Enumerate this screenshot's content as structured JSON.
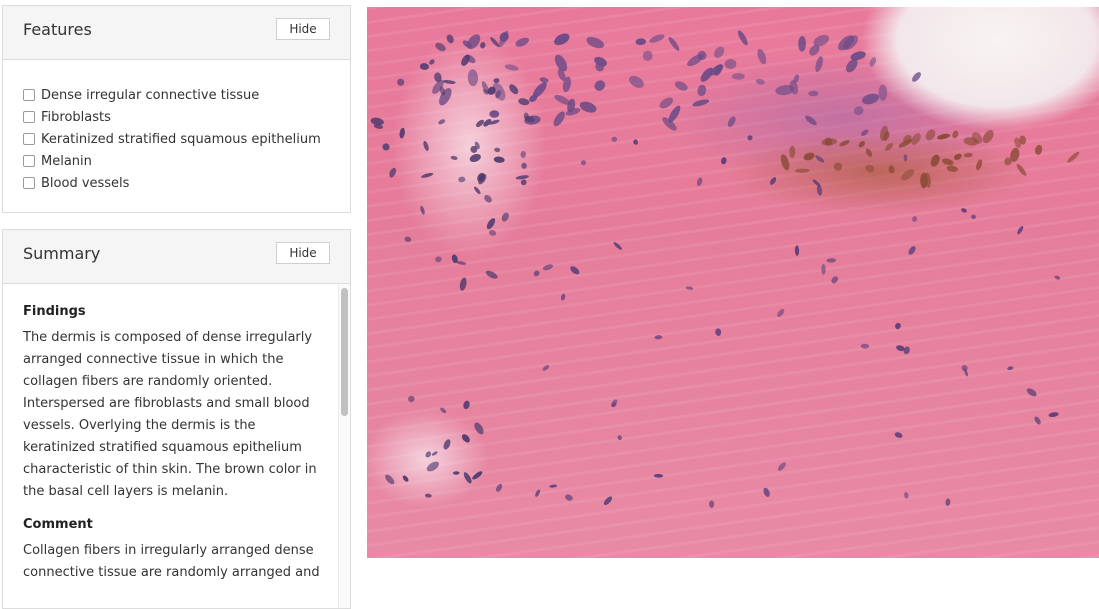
{
  "features_panel": {
    "title": "Features",
    "hide_label": "Hide",
    "items": [
      {
        "label": "Dense irregular connective tissue",
        "checked": false
      },
      {
        "label": "Fibroblasts",
        "checked": false
      },
      {
        "label": "Keratinized stratified squamous epithelium",
        "checked": false
      },
      {
        "label": "Melanin",
        "checked": false
      },
      {
        "label": "Blood vessels",
        "checked": false
      }
    ]
  },
  "summary_panel": {
    "title": "Summary",
    "hide_label": "Hide",
    "findings_heading": "Findings",
    "findings_text": "The dermis is composed of dense irregularly arranged connective tissue in which the collagen fibers are randomly oriented. Interspersed are fibroblasts and small blood vessels. Overlying the dermis is the keratinized stratified squamous epithelium characteristic of thin skin. The brown color in the basal cell layers is melanin.",
    "comment_heading": "Comment",
    "comment_text": "Collagen fibers in irregularly arranged dense connective tissue are randomly arranged and"
  },
  "image": {
    "description_icon": "histology-micrograph",
    "colors": {
      "stroma": "#e57d9a",
      "nuclei": "#5a3d7a",
      "melanin": "#9a4a2a"
    }
  }
}
